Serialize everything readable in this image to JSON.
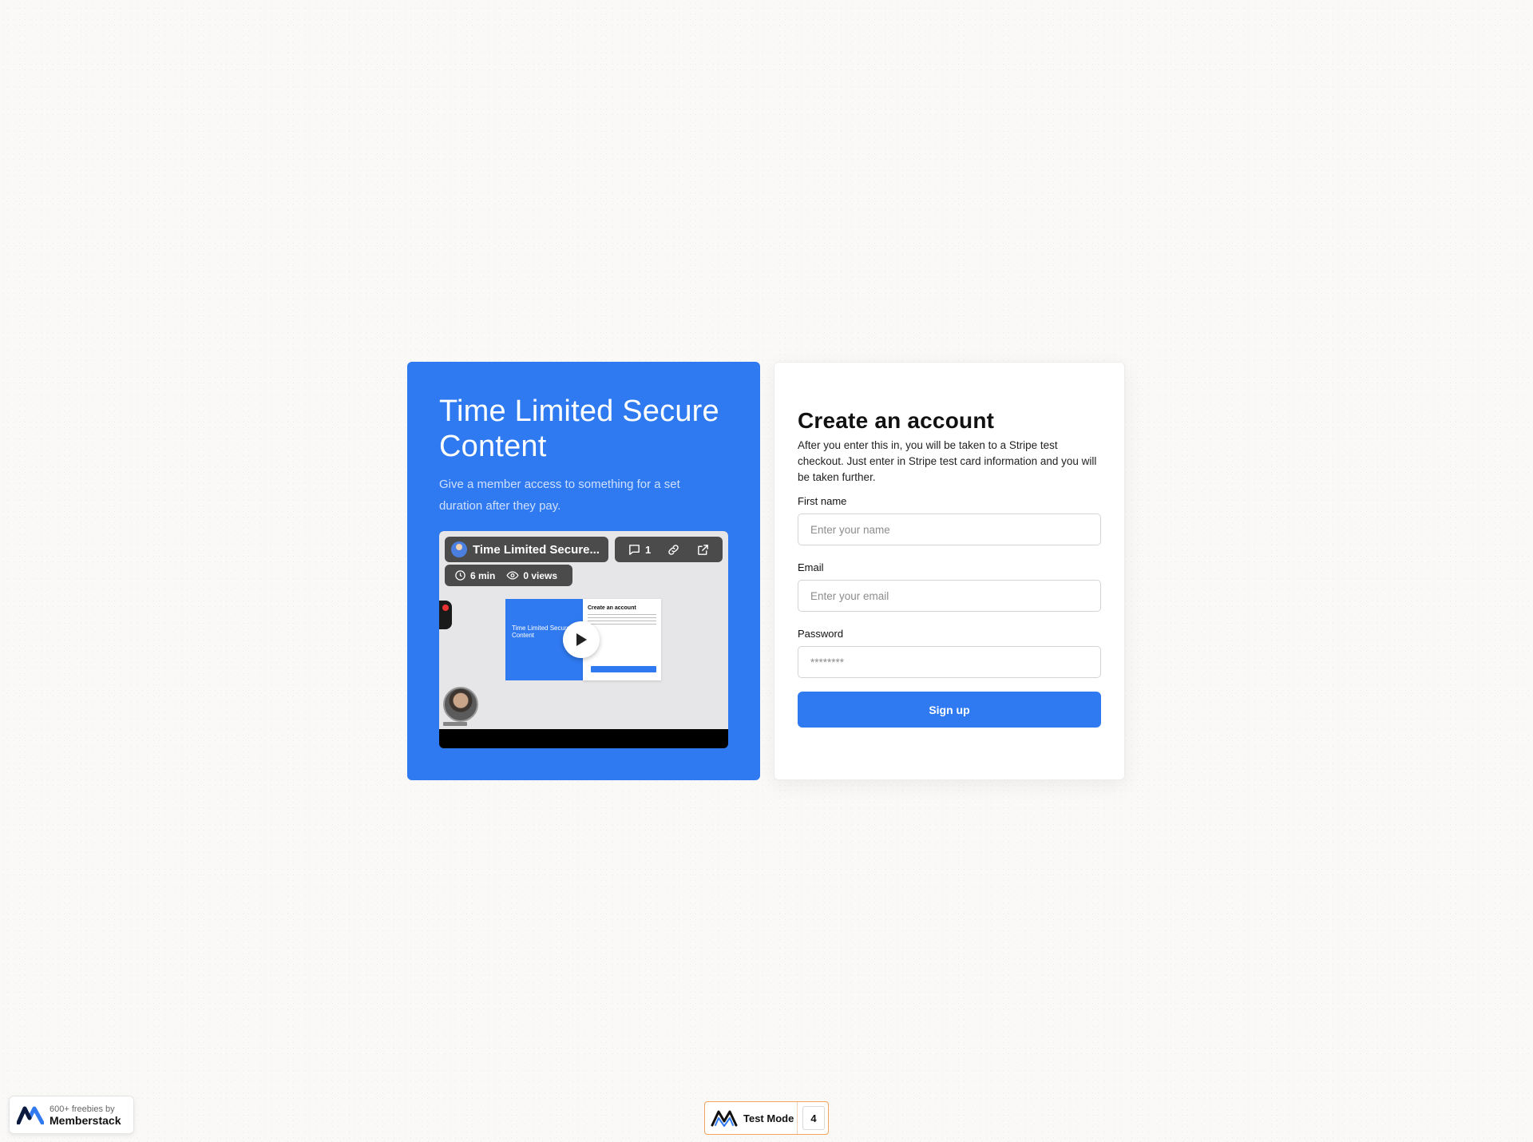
{
  "promo": {
    "title": "Time Limited Secure Content",
    "subtitle": "Give a member access to something for a set duration after they pay."
  },
  "video": {
    "title": "Time Limited Secure...",
    "comments": "1",
    "duration": "6 min",
    "views": "0 views",
    "preview_title": "Time Limited Secure Content",
    "preview_form_title": "Create an account"
  },
  "form": {
    "title": "Create an account",
    "description": "After you enter this in, you will be taken to a Stripe test checkout. Just enter in Stripe test card information and you will be taken further.",
    "first_name_label": "First name",
    "first_name_placeholder": "Enter your name",
    "email_label": "Email",
    "email_placeholder": "Enter your email",
    "password_label": "Password",
    "password_placeholder": "********",
    "submit_label": "Sign up"
  },
  "badge": {
    "small": "600+ freebies by",
    "big": "Memberstack"
  },
  "test_mode": {
    "label": "Test Mode",
    "count": "4"
  },
  "colors": {
    "accent": "#2f7af0",
    "test_mode_border": "#f3a35a"
  }
}
